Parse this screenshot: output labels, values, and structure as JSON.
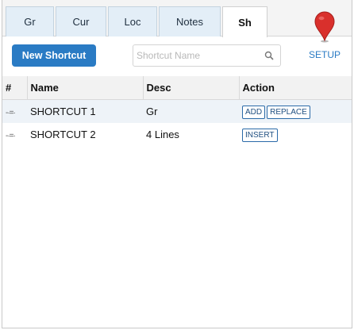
{
  "tabs": [
    {
      "label": "Gr",
      "active": false
    },
    {
      "label": "Cur",
      "active": false
    },
    {
      "label": "Loc",
      "active": false
    },
    {
      "label": "Notes",
      "active": false
    },
    {
      "label": "Sh",
      "active": true
    }
  ],
  "pin_icon": "map-pin-icon",
  "toolbar": {
    "new_button_label": "New Shortcut",
    "search_placeholder": "Shortcut Name",
    "search_icon": "search-icon",
    "setup_label": "SETUP"
  },
  "colors": {
    "accent": "#2a7bc4",
    "pin": "#d9302c",
    "row_alt": "#eef3f8",
    "tab_bg": "#e3eef7"
  },
  "table": {
    "columns": [
      "#",
      "Name",
      "Desc",
      "Action"
    ],
    "rows": [
      {
        "handle": "-·=·",
        "name": "SHORTCUT 1",
        "desc": "Gr",
        "actions": [
          "ADD",
          "REPLACE"
        ]
      },
      {
        "handle": "-·=·",
        "name": "SHORTCUT 2",
        "desc": "4 Lines",
        "actions": [
          "INSERT"
        ]
      }
    ]
  }
}
